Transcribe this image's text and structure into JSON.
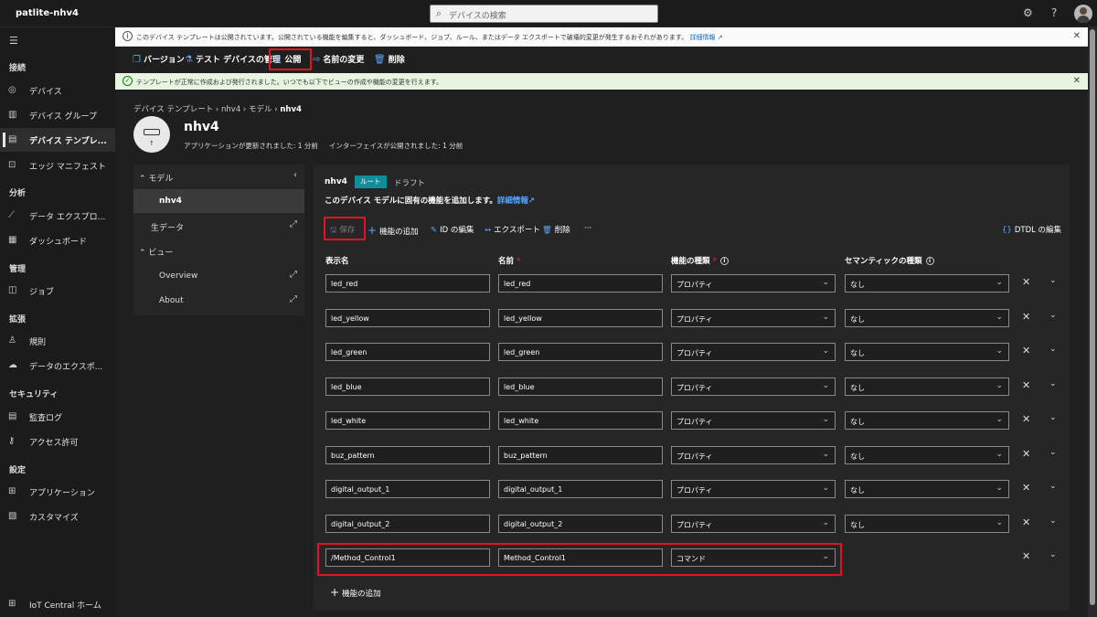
{
  "app": {
    "name": "patlite-nhv4"
  },
  "search": {
    "placeholder": "デバイスの検索"
  },
  "sidebar": {
    "sections": {
      "connect": "接続",
      "analyze": "分析",
      "manage": "管理",
      "extend": "拡張",
      "security": "セキュリティ",
      "settings": "設定"
    },
    "items": [
      {
        "label": "デバイス",
        "icon": "device-icon"
      },
      {
        "label": "デバイス グループ",
        "icon": "device-group-icon"
      },
      {
        "label": "デバイス テンプレ...",
        "icon": "template-icon"
      },
      {
        "label": "エッジ マニフェスト",
        "icon": "edge-manifest-icon"
      },
      {
        "label": "データ エクスプロ...",
        "icon": "data-explorer-icon"
      },
      {
        "label": "ダッシュボード",
        "icon": "dashboard-icon"
      },
      {
        "label": "ジョブ",
        "icon": "jobs-icon"
      },
      {
        "label": "規則",
        "icon": "rules-icon"
      },
      {
        "label": "データのエクスポ...",
        "icon": "data-export-icon"
      },
      {
        "label": "監査ログ",
        "icon": "audit-log-icon"
      },
      {
        "label": "アクセス許可",
        "icon": "permissions-icon"
      },
      {
        "label": "アプリケーション",
        "icon": "application-icon"
      },
      {
        "label": "カスタマイズ",
        "icon": "customize-icon"
      },
      {
        "label": "IoT Central ホーム",
        "icon": "home-icon"
      }
    ]
  },
  "banner_warning": {
    "text": "このデバイス テンプレートは公開されています。公開されている機能を編集すると、ダッシュボード、ジョブ、ルール、またはデータ エクスポートで破壊的変更が発生するおそれがあります。",
    "link": "詳細情報"
  },
  "toolbar": {
    "version": "バージョン",
    "test_device": "テスト デバイスの管理",
    "publish": "公開",
    "rename": "名前の変更",
    "delete": "削除"
  },
  "banner_success": {
    "text": "テンプレートが正常に作成および発行されました。いつでも以下でビューの作成や機能の変更を行えます。"
  },
  "breadcrumb": {
    "a": "デバイス テンプレート",
    "b": "nhv4",
    "c": "モデル",
    "d": "nhv4"
  },
  "device": {
    "name": "nhv4",
    "app_updated": "アプリケーションが更新されました: 1 分前",
    "interface_published": "インターフェイスが公開されました: 1 分前"
  },
  "tree": {
    "model": "モデル",
    "model_child": "nhv4",
    "raw_data": "生データ",
    "views": "ビュー",
    "overview": "Overview",
    "about": "About"
  },
  "model": {
    "name": "nhv4",
    "badge": "ルート",
    "status": "ドラフト",
    "description": "このデバイス モデルに固有の機能を追加します。",
    "link": "詳細情報"
  },
  "model_toolbar": {
    "save": "保存",
    "add_capability": "機能の追加",
    "edit_id": "ID の編集",
    "export": "エクスポート",
    "delete": "削除",
    "more": "···",
    "dtdl": "DTDL の編集"
  },
  "columns": {
    "display_name": "表示名",
    "name": "名前",
    "capability_type": "機能の種類",
    "semantic_type": "セマンティックの種類"
  },
  "rows": [
    {
      "display": "led_red",
      "name": "led_red",
      "type": "プロパティ",
      "semantic": "なし"
    },
    {
      "display": "led_yellow",
      "name": "led_yellow",
      "type": "プロパティ",
      "semantic": "なし"
    },
    {
      "display": "led_green",
      "name": "led_green",
      "type": "プロパティ",
      "semantic": "なし"
    },
    {
      "display": "led_blue",
      "name": "led_blue",
      "type": "プロパティ",
      "semantic": "なし"
    },
    {
      "display": "led_white",
      "name": "led_white",
      "type": "プロパティ",
      "semantic": "なし"
    },
    {
      "display": "buz_pattern",
      "name": "buz_pattern",
      "type": "プロパティ",
      "semantic": "なし"
    },
    {
      "display": "digital_output_1",
      "name": "digital_output_1",
      "type": "プロパティ",
      "semantic": "なし"
    },
    {
      "display": "digital_output_2",
      "name": "digital_output_2",
      "type": "プロパティ",
      "semantic": "なし"
    },
    {
      "display": "/Method_Control1",
      "name": "Method_Control1",
      "type": "コマンド",
      "semantic": ""
    }
  ],
  "add_capability": "機能の追加",
  "colors": {
    "accent": "#5aa7ff",
    "highlight": "#e81123",
    "badge": "#0f8e9a"
  }
}
